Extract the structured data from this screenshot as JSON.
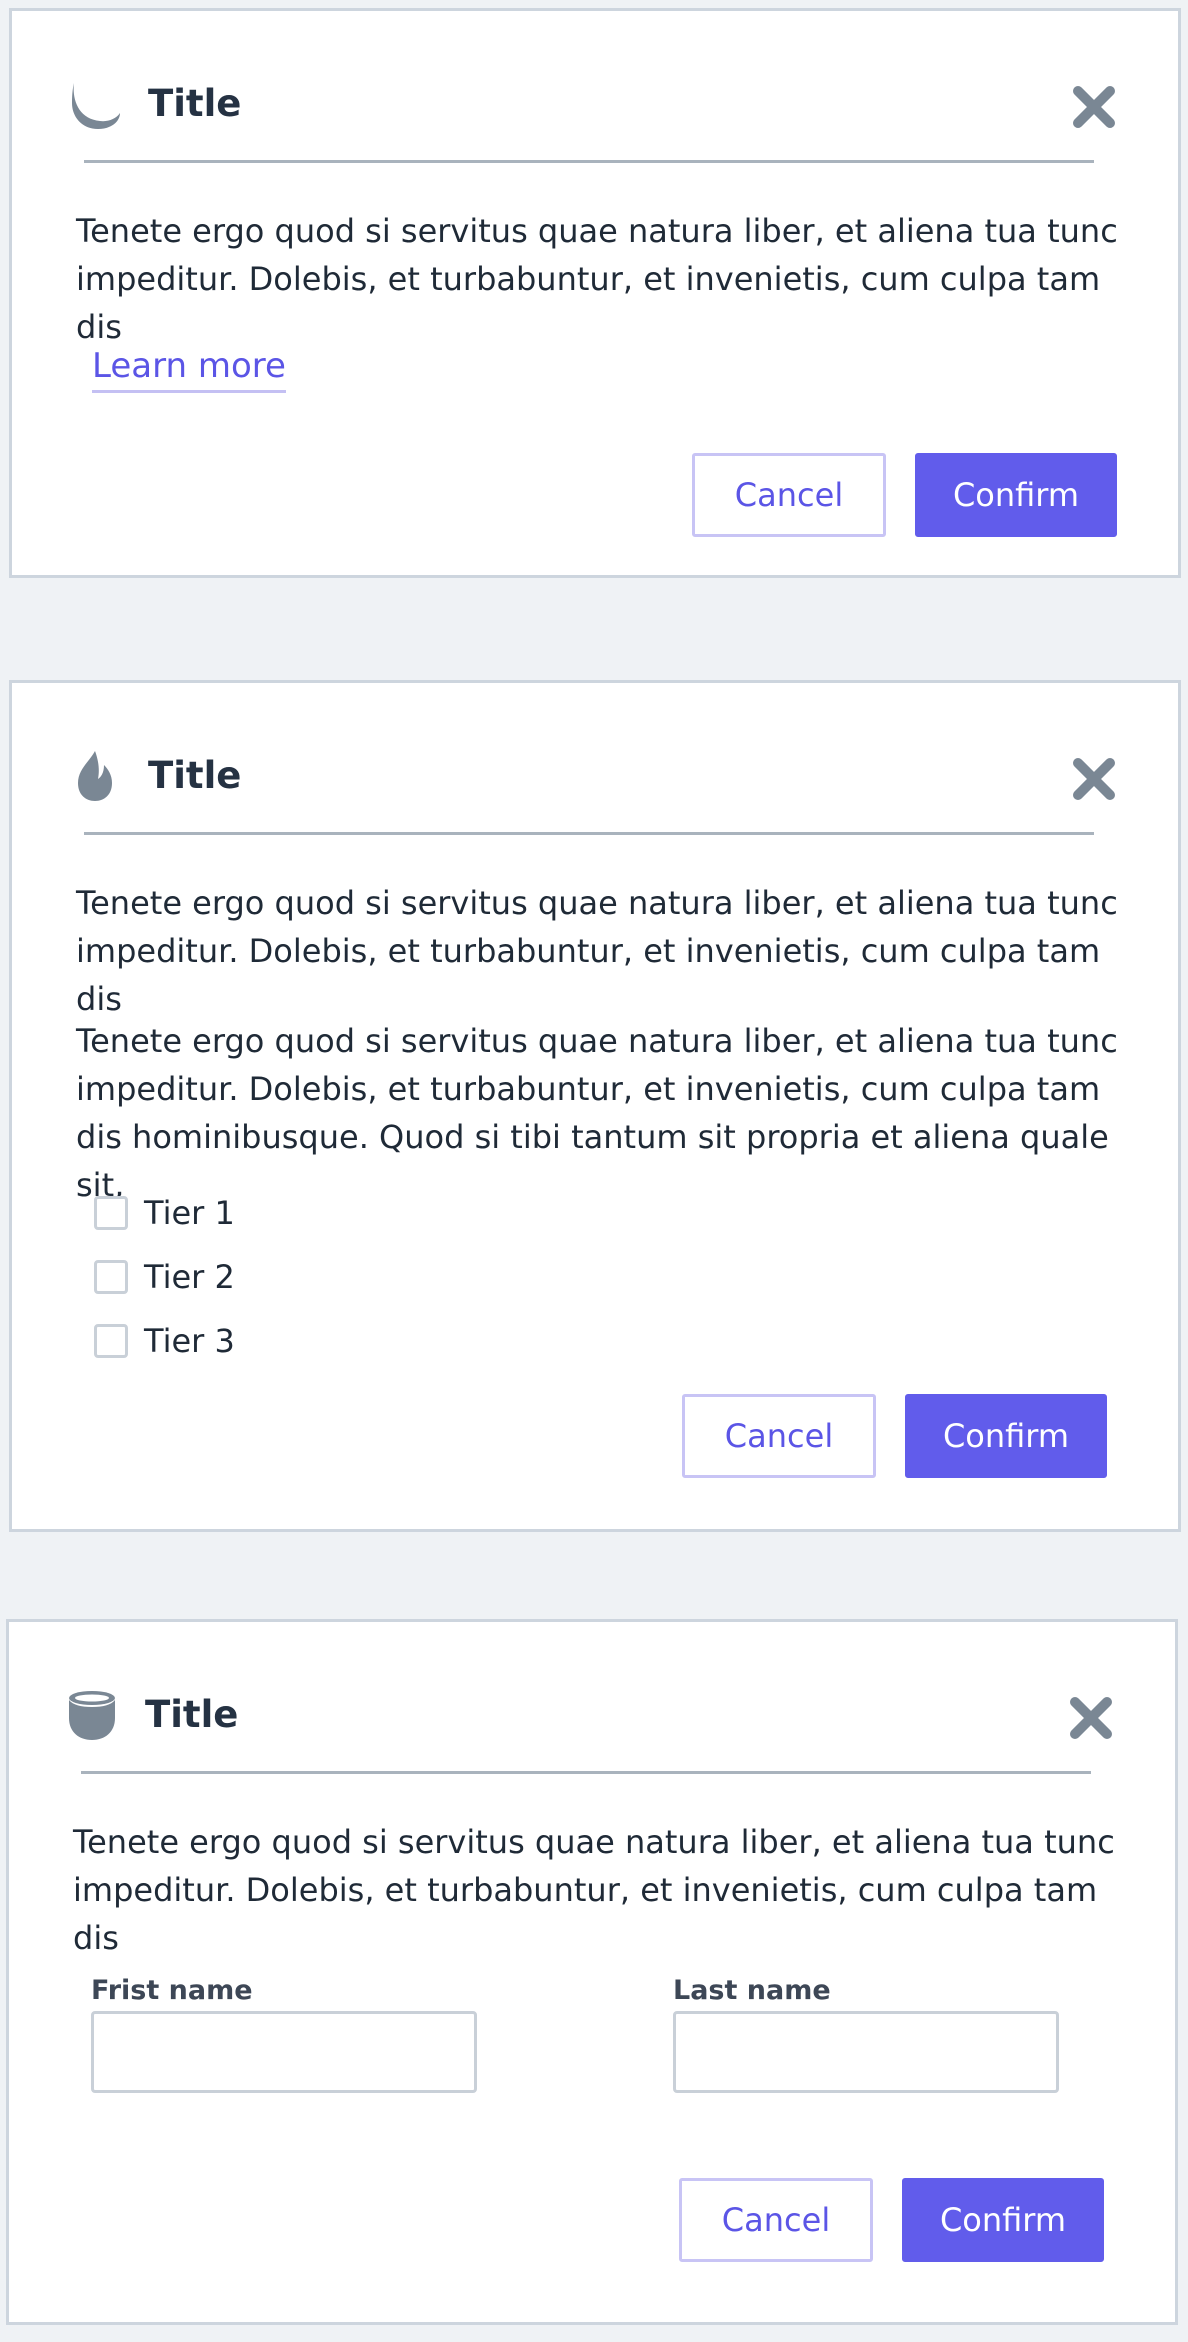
{
  "dialogs": [
    {
      "icon": "moon-icon",
      "title": "Title",
      "body": [
        "Tenete ergo quod si servitus quae natura liber, et aliena tua tunc impeditur. Dolebis, et turbabuntur, et invenietis, cum culpa tam dis"
      ],
      "link": "Learn more",
      "cancel": "Cancel",
      "confirm": "Confirm"
    },
    {
      "icon": "flame-icon",
      "title": "Title",
      "body": [
        "Tenete ergo quod si servitus quae natura liber, et aliena tua tunc impeditur. Dolebis, et turbabuntur, et invenietis, cum culpa tam dis",
        "Tenete ergo quod si servitus quae natura liber, et aliena tua tunc impeditur. Dolebis, et turbabuntur, et invenietis, cum culpa tam dis hominibusque. Quod si tibi tantum sit propria et aliena quale sit,"
      ],
      "options": [
        "Tier 1",
        "Tier 2",
        "Tier 3"
      ],
      "cancel": "Cancel",
      "confirm": "Confirm"
    },
    {
      "icon": "bowl-icon",
      "title": "Title",
      "body": [
        "Tenete ergo quod si servitus quae natura liber, et aliena tua tunc impeditur. Dolebis, et turbabuntur, et invenietis, cum culpa tam dis"
      ],
      "fields": [
        {
          "label": "Frist name",
          "value": ""
        },
        {
          "label": "Last name",
          "value": ""
        }
      ],
      "cancel": "Cancel",
      "confirm": "Confirm"
    }
  ],
  "colors": {
    "accent": "#615ceb",
    "link": "#5b55e6",
    "icon": "#7a8794",
    "background": "#eff2f5"
  }
}
